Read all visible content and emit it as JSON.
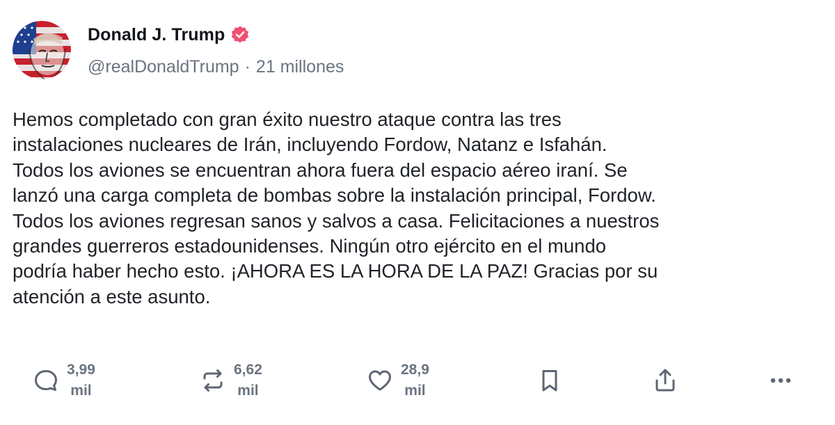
{
  "post": {
    "author": {
      "display_name": "Donald J. Trump",
      "verified_color": "#f0506e",
      "handle": "@realDonaldTrump",
      "separator": "·",
      "followers": "21 millones"
    },
    "text": "Hemos completado con gran éxito nuestro ataque contra las tres\ninstalaciones nucleares de Irán, incluyendo Fordow, Natanz e Isfahán.\nTodos los aviones se encuentran ahora fuera del espacio aéreo iraní. Se\nlanzó una carga completa de bombas sobre la instalación principal, Fordow.\nTodos los aviones regresan sanos y salvos a casa. Felicitaciones a nuestros\ngrandes guerreros estadounidenses. Ningún otro ejército en el mundo\npodría haber hecho esto. ¡AHORA ES LA HORA DE LA PAZ! Gracias por su\natención a este asunto.",
    "actions": {
      "replies": {
        "value": "3,99",
        "unit": "mil",
        "icon": "reply-icon"
      },
      "reposts": {
        "value": "6,62",
        "unit": "mil",
        "icon": "repost-icon"
      },
      "likes": {
        "value": "28,9",
        "unit": "mil",
        "icon": "heart-icon"
      },
      "bookmark": {
        "icon": "bookmark-icon"
      },
      "share": {
        "icon": "share-icon"
      },
      "more": {
        "icon": "more-icon"
      }
    }
  },
  "colors": {
    "text": "#1f2328",
    "muted": "#6b7480",
    "icon": "#5d6672",
    "accent_verified": "#f0506e"
  }
}
